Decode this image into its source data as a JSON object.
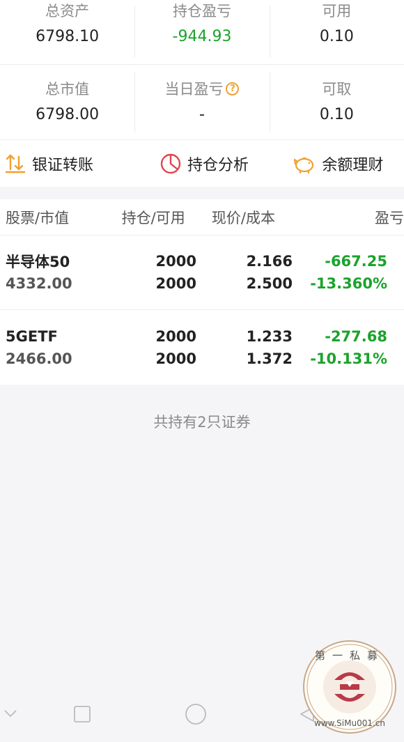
{
  "summary": {
    "total_assets_label": "总资产",
    "total_assets_value": "6798.10",
    "position_pl_label": "持仓盈亏",
    "position_pl_value": "-944.93",
    "available_label": "可用",
    "available_value": "0.10",
    "market_value_label": "总市值",
    "market_value_value": "6798.00",
    "daily_pl_label": "当日盈亏",
    "daily_pl_value": "-",
    "withdrawable_label": "可取",
    "withdrawable_value": "0.10"
  },
  "actions": {
    "transfer_label": "银证转账",
    "analysis_label": "持仓分析",
    "wealth_label": "余额理财"
  },
  "table": {
    "headers": [
      "股票/市值",
      "持仓/可用",
      "现价/成本",
      "盈亏"
    ],
    "rows": [
      {
        "name": "半导体50",
        "market_value": "4332.00",
        "position": "2000",
        "available": "2000",
        "price": "2.166",
        "cost": "2.500",
        "pl": "-667.25",
        "pl_pct": "-13.360%"
      },
      {
        "name": "5GETF",
        "market_value": "2466.00",
        "position": "2000",
        "available": "2000",
        "price": "1.233",
        "cost": "1.372",
        "pl": "-277.68",
        "pl_pct": "-10.131%"
      }
    ]
  },
  "holdings_note": "共持有2只证券",
  "watermark": {
    "text_top": "第一私募",
    "text_bottom": "www.SiMu001.cn"
  },
  "colors": {
    "loss_green": "#1aa32b",
    "accent_orange": "#f0a030",
    "accent_red": "#e0454f"
  }
}
